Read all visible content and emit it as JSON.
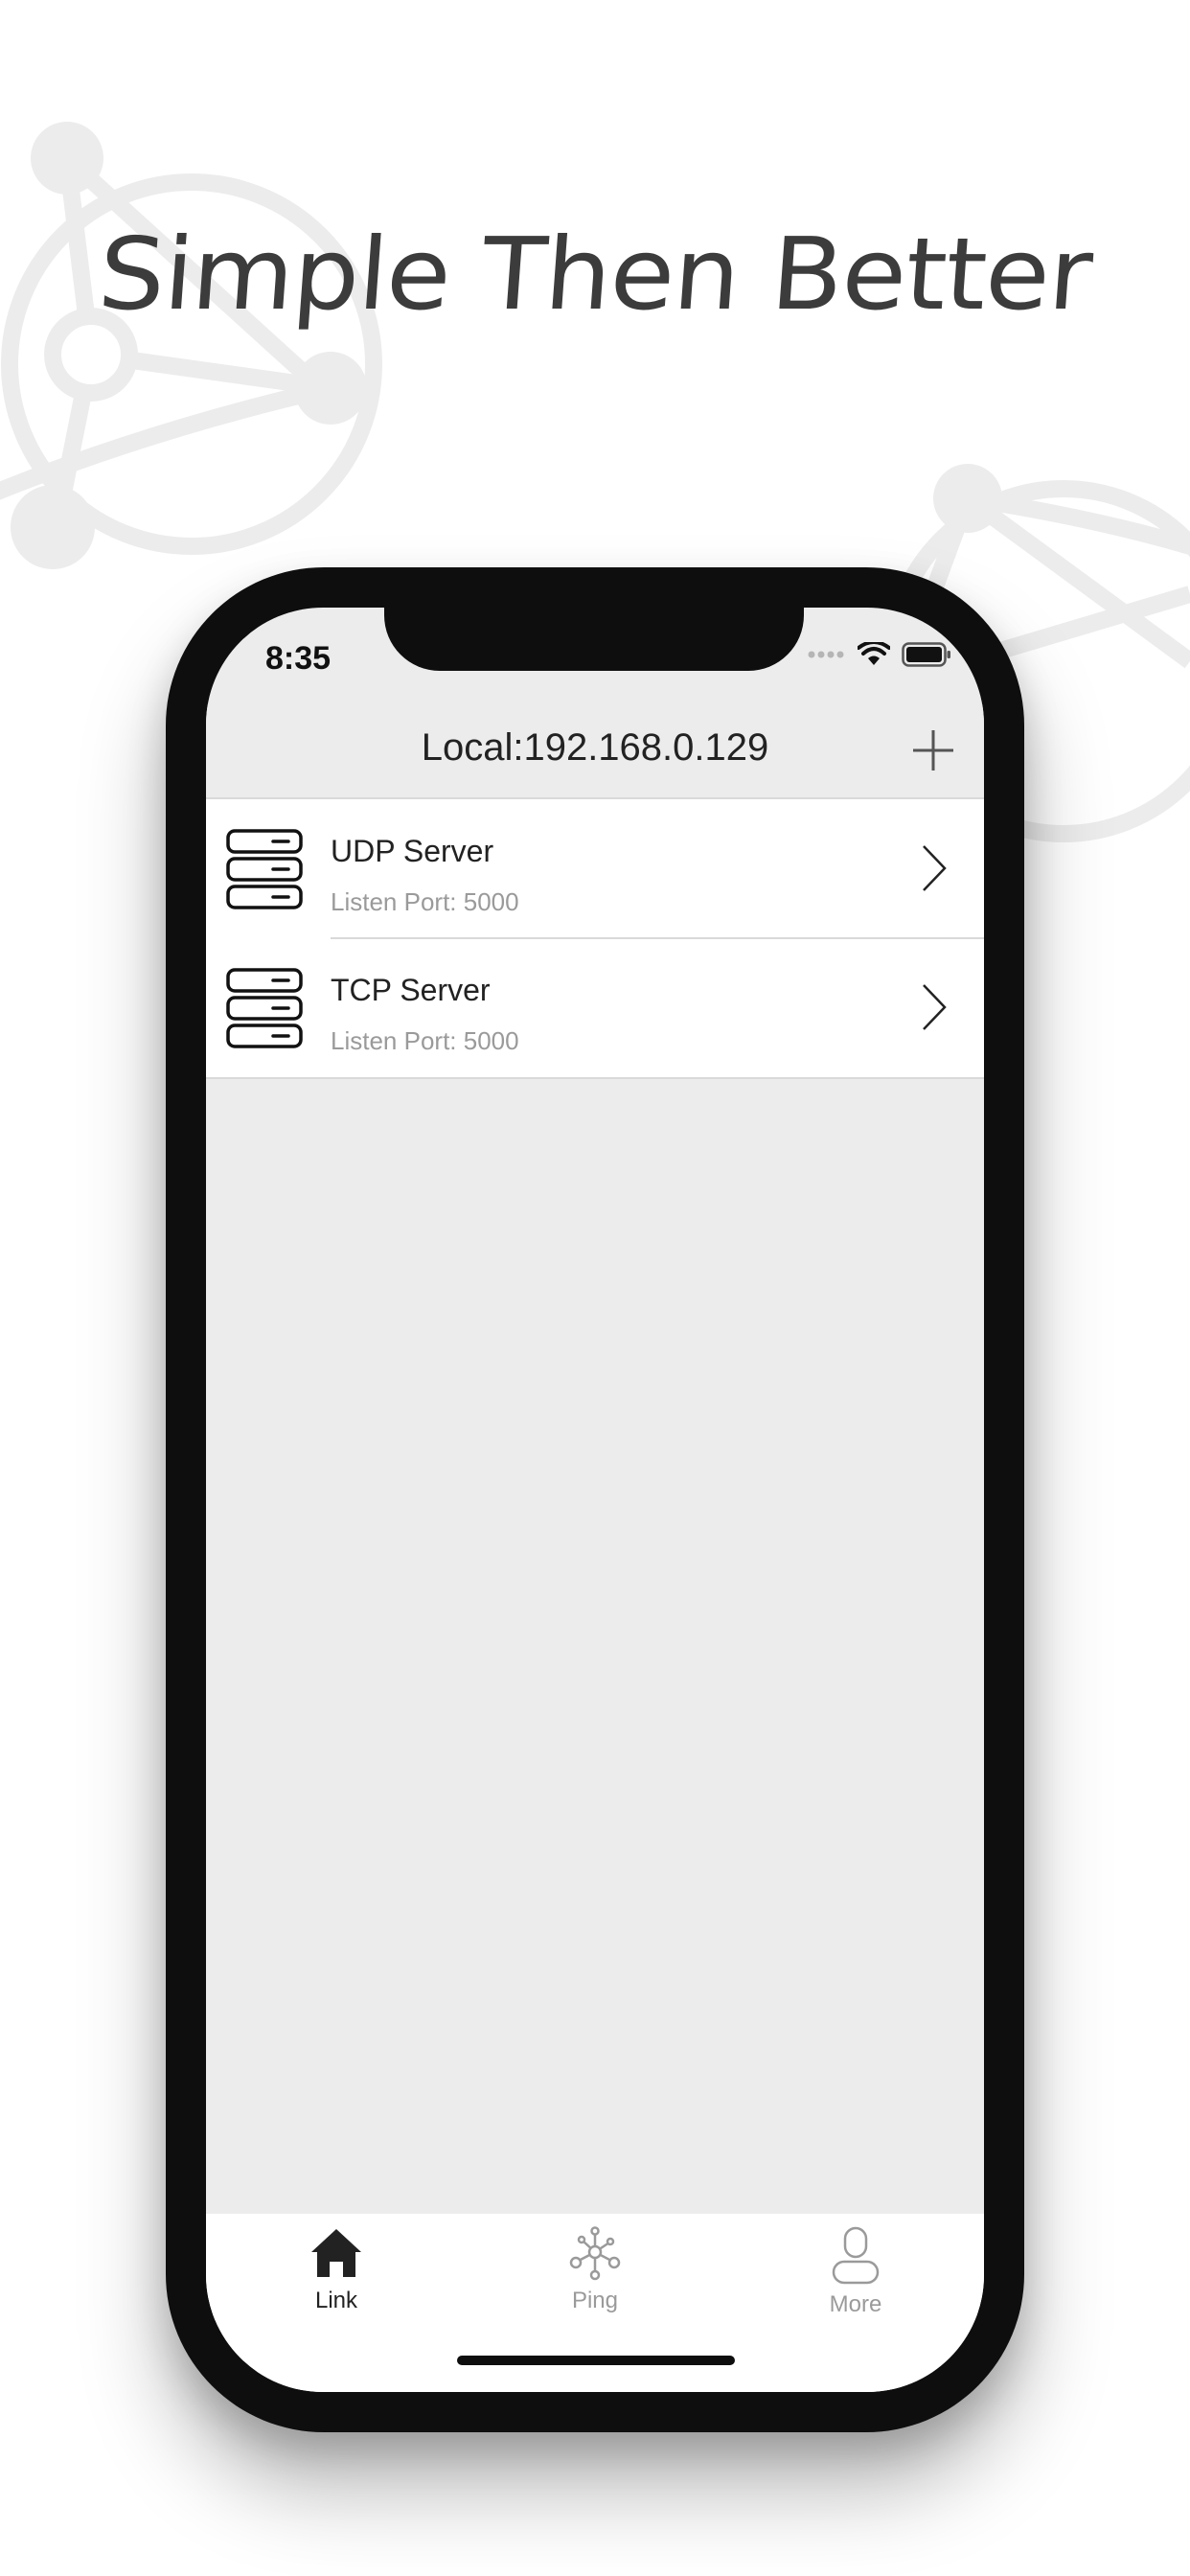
{
  "headline": "Simple Then Better",
  "status_bar": {
    "time": "8:35"
  },
  "navbar": {
    "title": "Local:192.168.0.129",
    "add_icon": "plus-icon"
  },
  "servers": [
    {
      "title": "UDP Server",
      "subtitle": "Listen Port: 5000",
      "icon": "server-icon"
    },
    {
      "title": "TCP Server",
      "subtitle": "Listen Port: 5000",
      "icon": "server-icon"
    }
  ],
  "tabs": [
    {
      "label": "Link",
      "icon": "home-icon",
      "active": true
    },
    {
      "label": "Ping",
      "icon": "network-nodes-icon",
      "active": false
    },
    {
      "label": "More",
      "icon": "user-icon",
      "active": false
    }
  ],
  "colors": {
    "list_background": "#ececec",
    "active_tab": "#222222",
    "inactive_tab": "#9a9a9a",
    "phone_frame": "#0e0e0e"
  }
}
